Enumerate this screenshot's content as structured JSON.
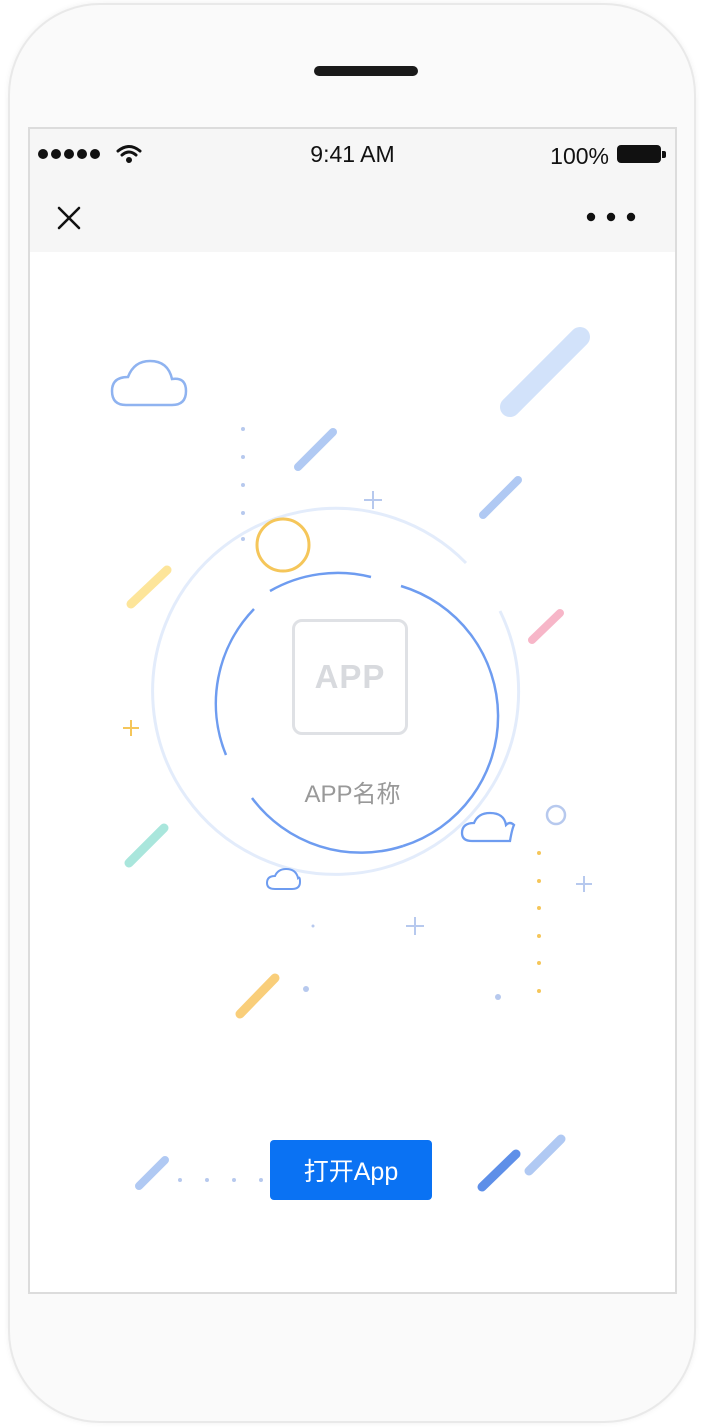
{
  "status_bar": {
    "time": "9:41 AM",
    "battery_percent": "100%",
    "signal_bars": 5
  },
  "nav": {
    "close_icon": "close-icon",
    "more_icon": "more-dots-icon"
  },
  "app": {
    "icon_text": "APP",
    "name": "APP名称"
  },
  "action": {
    "open_button_label": "打开App"
  },
  "colors": {
    "primary_button": "#0a72f3",
    "ring_blue": "#6e9cf0",
    "ring_light": "#e3ecfb",
    "accent_yellow": "#f5c65a",
    "accent_pink": "#f7b6c8",
    "accent_teal": "#a9e6dc"
  }
}
